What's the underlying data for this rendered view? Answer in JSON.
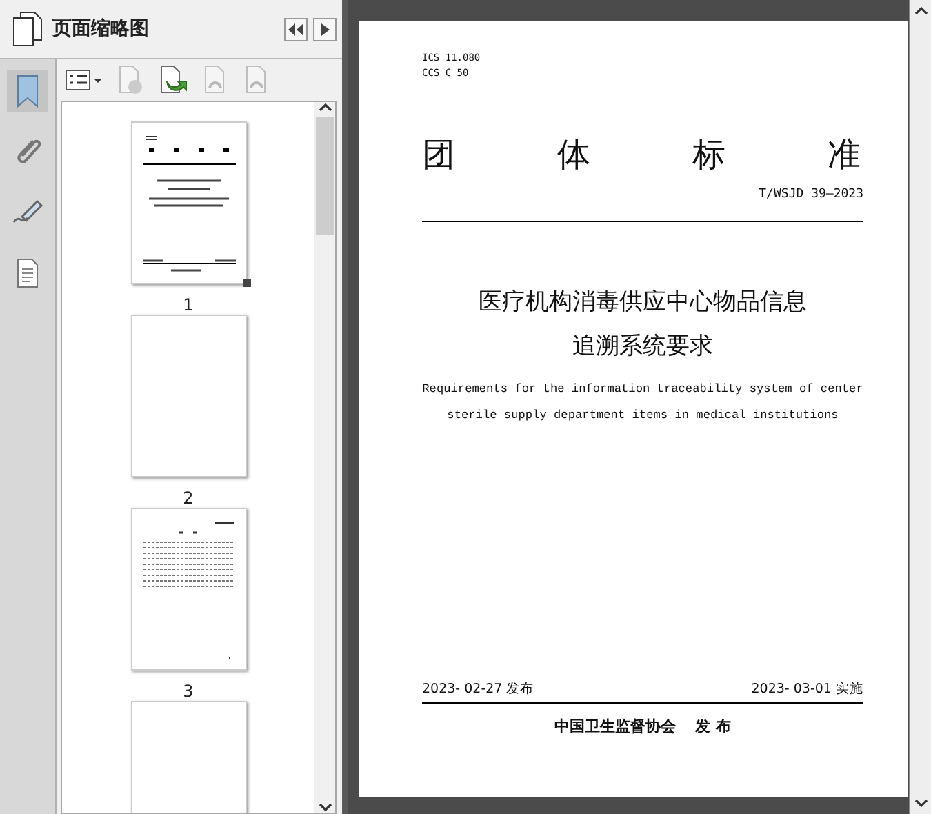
{
  "panel": {
    "title": "页面缩略图"
  },
  "rail": [
    {
      "kind": "bookmark",
      "selected": true
    },
    {
      "kind": "clip",
      "selected": false
    },
    {
      "kind": "pen",
      "selected": false
    },
    {
      "kind": "doc",
      "selected": false
    }
  ],
  "toolbar": [
    {
      "kind": "options",
      "disabled": false
    },
    {
      "kind": "delete",
      "disabled": true
    },
    {
      "kind": "insert",
      "disabled": false
    },
    {
      "kind": "undo",
      "disabled": true
    },
    {
      "kind": "redo",
      "disabled": true
    }
  ],
  "thumbnails": [
    {
      "kind": "cover",
      "label": "1",
      "selected": true
    },
    {
      "kind": "blank",
      "label": "2",
      "selected": false
    },
    {
      "kind": "toc",
      "label": "3",
      "selected": false
    },
    {
      "kind": "blank",
      "selected": false
    }
  ],
  "document": {
    "codes": [
      "ICS 11.080",
      "CCS C 50"
    ],
    "heading": [
      "团",
      "体",
      "标",
      "准"
    ],
    "number": "T/WSJD 39—2023",
    "title_lines": [
      "医疗机构消毒供应中心物品信息",
      "追溯系统要求"
    ],
    "english_lines": [
      "Requirements for the information traceability system of center",
      "sterile supply department items in medical institutions"
    ],
    "published": "2023- 02-27 发布",
    "effective": "2023- 03-01 实施",
    "publisher": "中国卫生监督协会",
    "publisher_suffix": "发 布"
  }
}
